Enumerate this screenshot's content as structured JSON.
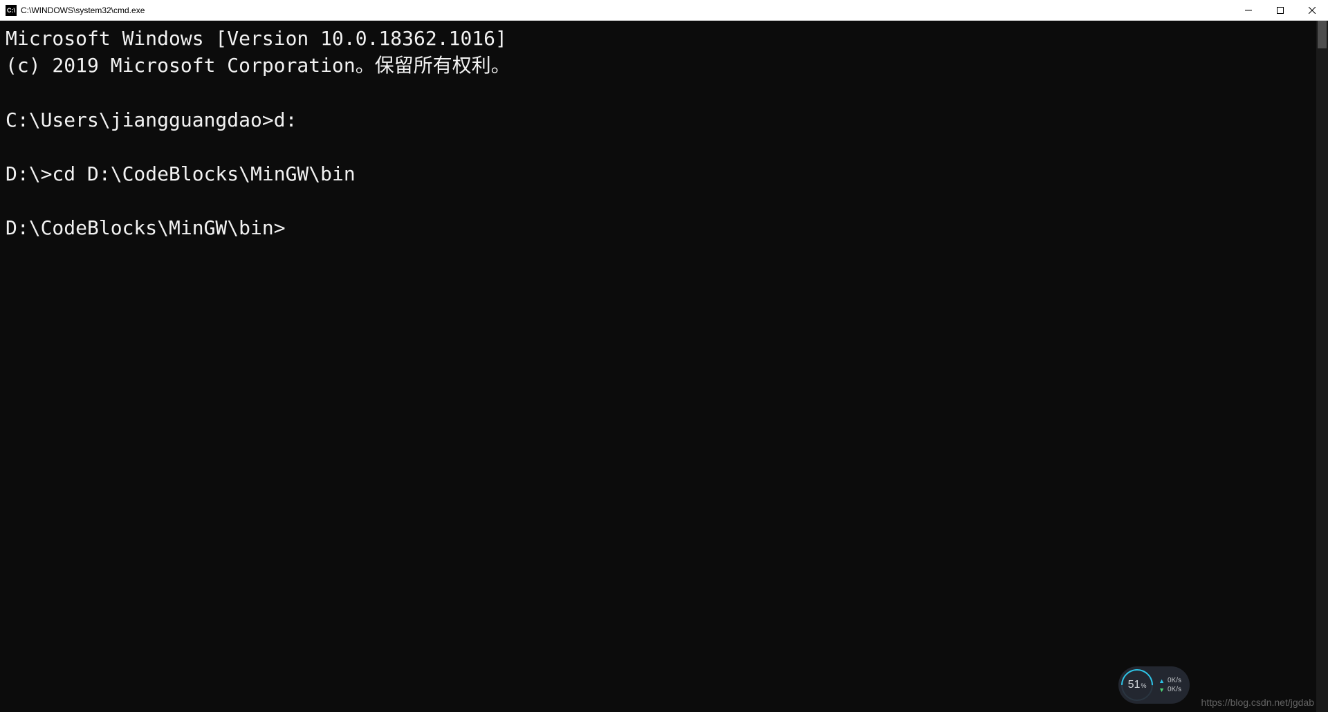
{
  "window": {
    "title": "C:\\WINDOWS\\system32\\cmd.exe",
    "app_icon_label": "C:\\"
  },
  "terminal": {
    "lines": [
      "Microsoft Windows [Version 10.0.18362.1016]",
      "(c) 2019 Microsoft Corporation。保留所有权利。",
      "",
      "C:\\Users\\jiangguangdao>d:",
      "",
      "D:\\>cd D:\\CodeBlocks\\MinGW\\bin",
      "",
      "D:\\CodeBlocks\\MinGW\\bin>"
    ]
  },
  "widget": {
    "gauge_value": "51",
    "gauge_unit": "%",
    "upload_speed": "0K/s",
    "download_speed": "0K/s"
  },
  "watermark": "https://blog.csdn.net/jgdab"
}
